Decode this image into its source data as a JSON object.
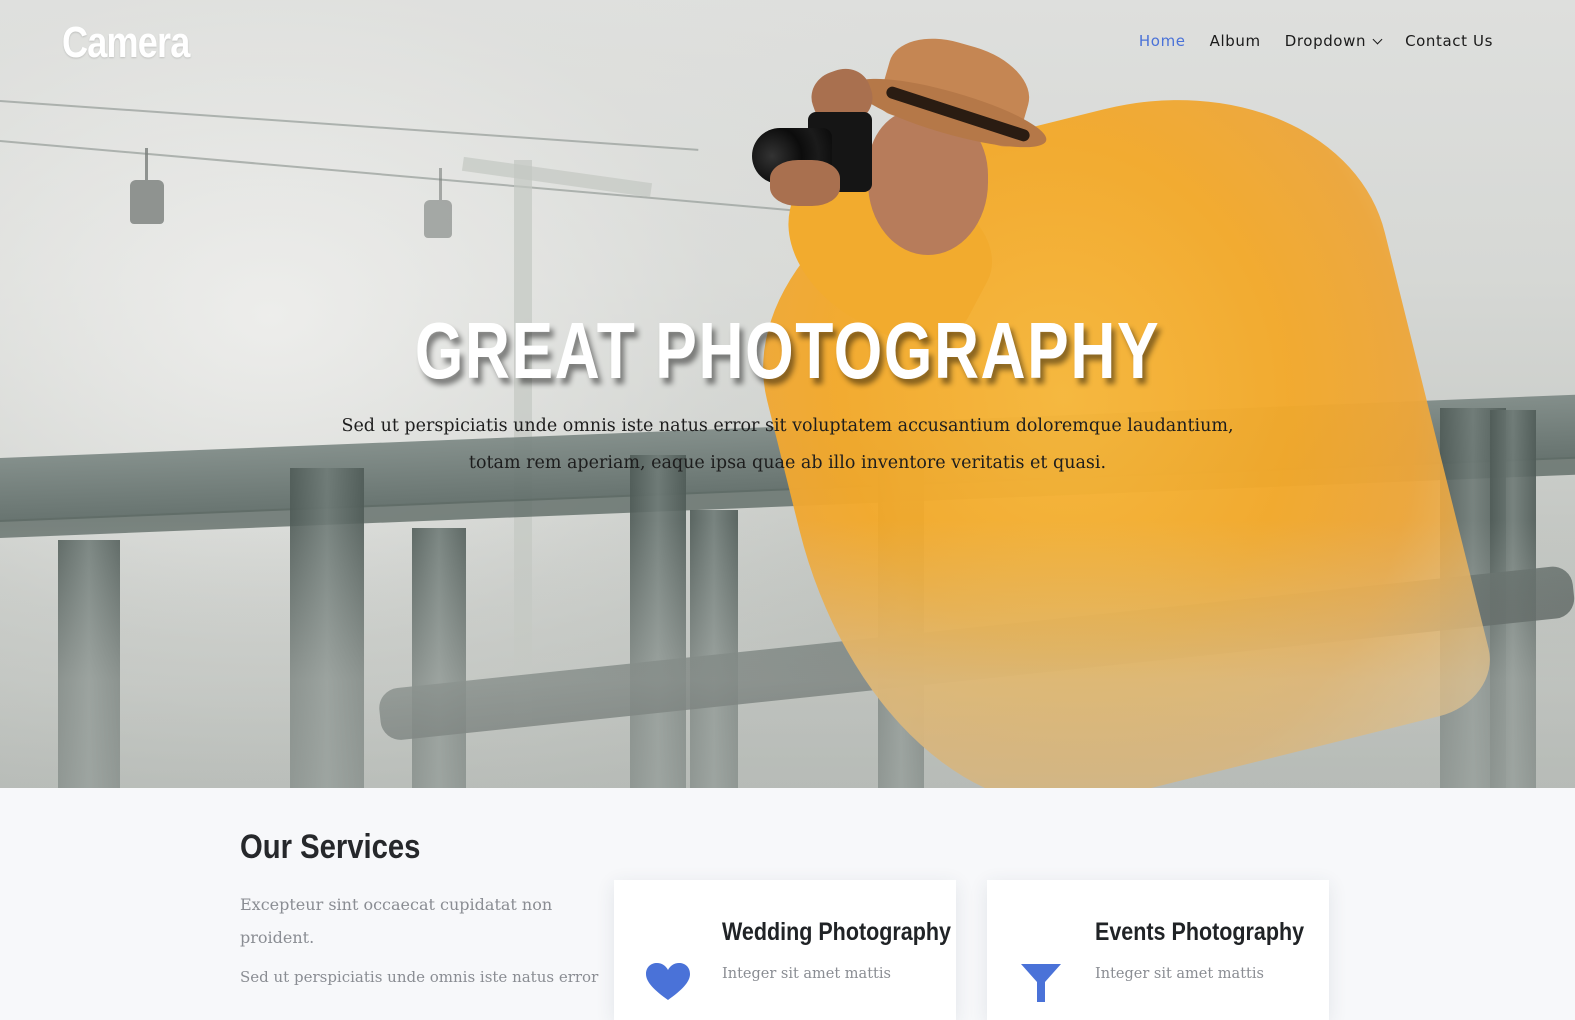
{
  "brand": {
    "name": "Camera"
  },
  "nav": {
    "items": [
      {
        "label": "Home",
        "active": true
      },
      {
        "label": "Album",
        "active": false
      },
      {
        "label": "Dropdown",
        "active": false,
        "has_dropdown": true
      },
      {
        "label": "Contact Us",
        "active": false
      }
    ]
  },
  "hero": {
    "title": "GREAT PHOTOGRAPHY",
    "subtitle_line1": "Sed ut perspiciatis unde omnis iste natus error sit voluptatem accusantium doloremque laudantium,",
    "subtitle_line2": "totam rem aperiam, eaque ipsa quae ab illo inventore veritatis et quasi."
  },
  "services": {
    "title": "Our Services",
    "description": "Excepteur sint occaecat cupidatat non proident.",
    "description2": "Sed ut perspiciatis unde omnis iste natus error",
    "cards": [
      {
        "title": "Wedding Photography",
        "text": "Integer sit amet mattis",
        "icon": "heart-icon"
      },
      {
        "title": "Events Photography",
        "text": "Integer sit amet mattis",
        "icon": "glass-icon"
      }
    ]
  },
  "colors": {
    "accent": "#4a72d8",
    "jacket": "#f3a92a",
    "services_bg": "#f7f8fa"
  }
}
